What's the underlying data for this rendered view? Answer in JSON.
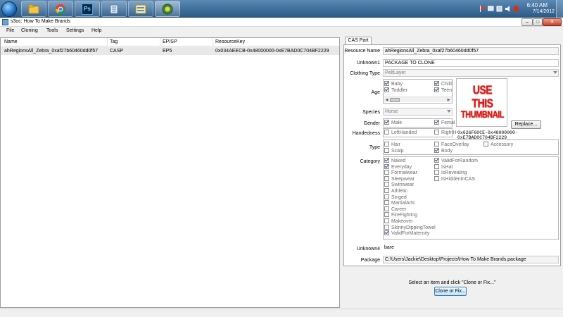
{
  "window": {
    "title": "s3oc: How To Make Brands"
  },
  "titlebar_buttons": {
    "minimize": "–",
    "maximize": "□",
    "close": "✕"
  },
  "taskbar": {
    "apps": [
      "windows-explorer",
      "chrome",
      "photoshop",
      "notepad",
      "file-manager",
      "s3oc"
    ],
    "clock_time": "6:40 AM",
    "clock_date": "7/14/2012",
    "photoshop_label": "Ps"
  },
  "menu": [
    "File",
    "Cloning",
    "Tools",
    "Settings",
    "Help"
  ],
  "list": {
    "columns": [
      "Name",
      "Tag",
      "EP/SP",
      "ResourceKey"
    ],
    "rows": [
      {
        "name": "ahRegionsAll_Zebra_0xaf27b60460dd0f57",
        "tag": "CASP",
        "ep": "EP5",
        "key": "0x034AEECB-0x48000000-0xE7BAD0C704BF2229"
      }
    ]
  },
  "tab": {
    "label": "CAS Part"
  },
  "form": {
    "resource_name_label": "Resource Name",
    "resource_name": "ahRegionsAll_Zebra_0xaf27b60460dd0f57",
    "unknown1_label": "Unknown1",
    "unknown1": "PACKAGE TO CLONE",
    "clothing_type_label": "Clothing Type",
    "clothing_type": "PeltLayer",
    "age_label": "Age",
    "age_options": [
      {
        "label": "Baby",
        "checked": true
      },
      {
        "label": "Child",
        "checked": true
      },
      {
        "label": "Toddler",
        "checked": true
      },
      {
        "label": "Teen",
        "checked": true
      }
    ],
    "thumbnail_text": [
      "USE",
      "THIS",
      "THUMBNAIL"
    ],
    "replace_label": "Replace...",
    "hash": "0x626F60CE-0x48000000-0xE7BAD0C704BF2229",
    "species_label": "Species",
    "species": "Horse",
    "gender_label": "Gender",
    "gender_options": [
      {
        "label": "Male",
        "checked": true
      },
      {
        "label": "Femal",
        "checked": true
      }
    ],
    "handedness_label": "Handedness",
    "handedness_options": [
      {
        "label": "LeftHanded",
        "checked": false
      },
      {
        "label": "RightH",
        "checked": false
      }
    ],
    "type_label": "Type",
    "type_options": [
      {
        "label": "Hair",
        "checked": false
      },
      {
        "label": "FaceOverlay",
        "checked": false
      },
      {
        "label": "Accessory",
        "checked": false
      },
      {
        "label": "Scalp",
        "checked": false
      },
      {
        "label": "Body",
        "checked": true
      }
    ],
    "category_label": "Category",
    "category_left": [
      {
        "label": "Naked",
        "checked": true
      },
      {
        "label": "Everyday",
        "checked": true
      },
      {
        "label": "Formalwear",
        "checked": false
      },
      {
        "label": "Sleepwear",
        "checked": false
      },
      {
        "label": "Swimwear",
        "checked": false
      },
      {
        "label": "Athletic",
        "checked": false
      },
      {
        "label": "Singed",
        "checked": false
      },
      {
        "label": "MartialArts",
        "checked": false
      },
      {
        "label": "Career",
        "checked": false
      },
      {
        "label": "FireFighting",
        "checked": false
      },
      {
        "label": "Makeover",
        "checked": false
      },
      {
        "label": "SkinnyDippingTowel",
        "checked": false
      },
      {
        "label": "ValidForMaternity",
        "checked": true
      }
    ],
    "category_right": [
      {
        "label": "ValidForRandom",
        "checked": true
      },
      {
        "label": "IsHat",
        "checked": false
      },
      {
        "label": "IsRevealing",
        "checked": false
      },
      {
        "label": "IsHiddenInCAS",
        "checked": false
      }
    ],
    "unknown4_label": "Unknown4",
    "unknown4": "bare",
    "package_label": "Package",
    "package": "C:\\Users\\Jackie\\Desktop\\Projects\\How To Make Brands.package"
  },
  "footer": {
    "message": "Select an item and click \"Clone or Fix...\"",
    "clone_button": "Clone or Fix..."
  },
  "colors": {
    "thumbnail_text": "#e8150f",
    "selection_row": "#e8e8e8",
    "taskbar": "#3a6a96"
  }
}
